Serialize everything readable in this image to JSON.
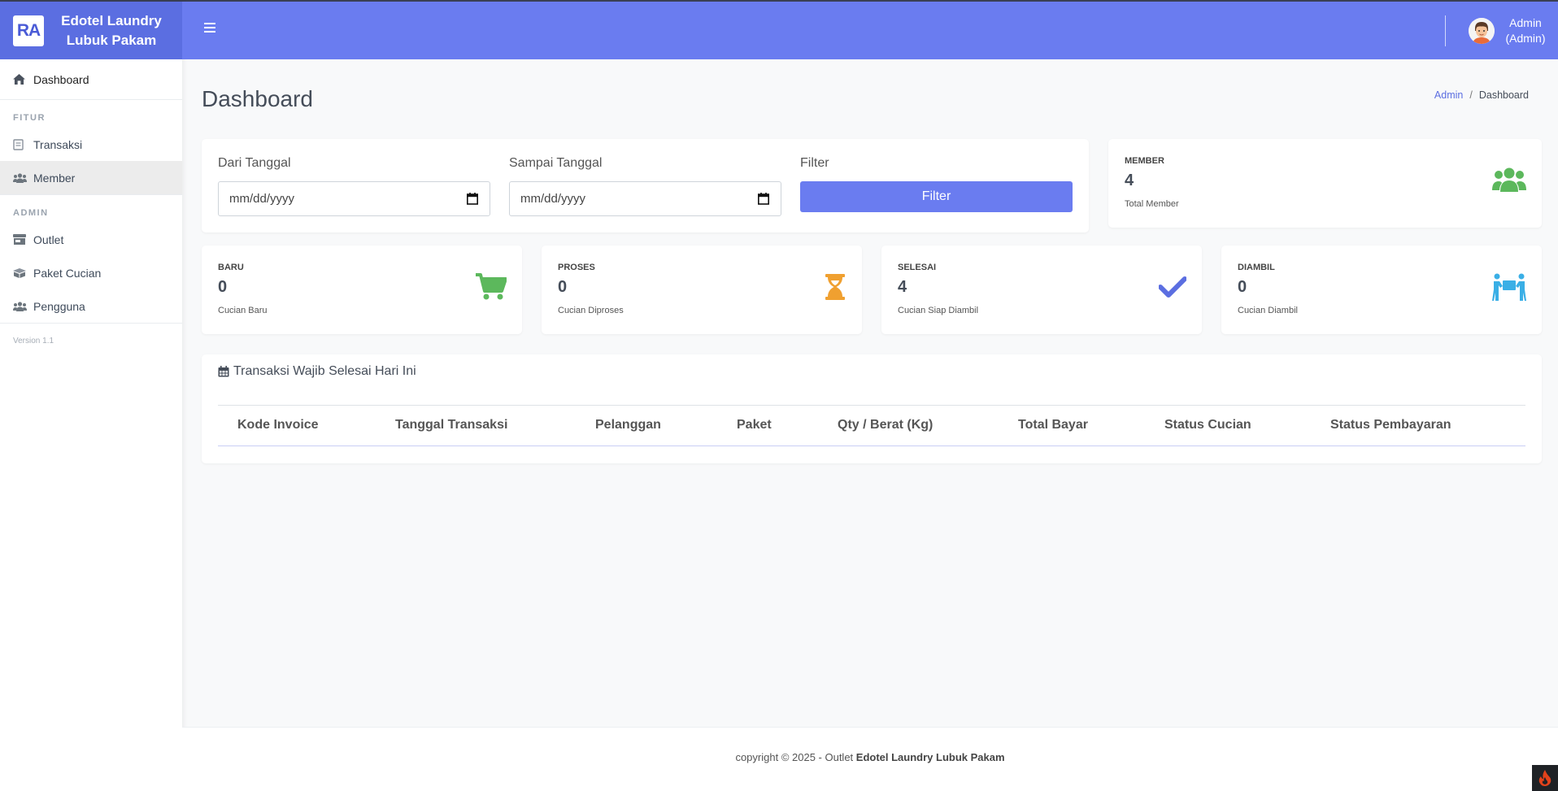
{
  "brand": {
    "logo_text": "RA",
    "name_line1": "Edotel Laundry",
    "name_line2": "Lubuk Pakam"
  },
  "sidebar": {
    "dashboard": "Dashboard",
    "fitur_heading": "FITUR",
    "fitur_items": [
      {
        "label": "Transaksi",
        "icon": "receipt-icon"
      },
      {
        "label": "Member",
        "icon": "users-icon"
      }
    ],
    "admin_heading": "ADMIN",
    "admin_items": [
      {
        "label": "Outlet",
        "icon": "store-icon"
      },
      {
        "label": "Paket Cucian",
        "icon": "box-icon"
      },
      {
        "label": "Pengguna",
        "icon": "users-icon"
      }
    ],
    "version": "Version 1.1"
  },
  "navbar": {
    "user_line1": "Admin",
    "user_line2": "(Admin)"
  },
  "page": {
    "title": "Dashboard",
    "breadcrumb": [
      "Admin",
      "Dashboard"
    ]
  },
  "filter": {
    "from_label": "Dari Tanggal",
    "from_placeholder": "mm/dd/yyyy",
    "to_label": "Sampai Tanggal",
    "to_placeholder": "mm/dd/yyyy",
    "filter_label": "Filter",
    "button": "Filter"
  },
  "stats": {
    "member": {
      "label": "MEMBER",
      "value": "4",
      "sub": "Total Member",
      "icon": "users-icon",
      "color": "#5cb85c"
    },
    "baru": {
      "label": "BARU",
      "value": "0",
      "sub": "Cucian Baru",
      "icon": "cart-icon",
      "color": "#5cb85c"
    },
    "proses": {
      "label": "PROSES",
      "value": "0",
      "sub": "Cucian Diproses",
      "icon": "hourglass-icon",
      "color": "#f0a030"
    },
    "selesai": {
      "label": "SELESAI",
      "value": "4",
      "sub": "Cucian Siap Diambil",
      "icon": "check-icon",
      "color": "#5b6ee1"
    },
    "diambil": {
      "label": "DIAMBIL",
      "value": "0",
      "sub": "Cucian Diambil",
      "icon": "people-carry-icon",
      "color": "#3aafe6"
    }
  },
  "table": {
    "title": "Transaksi Wajib Selesai Hari Ini",
    "columns": [
      "Kode Invoice",
      "Tanggal Transaksi",
      "Pelanggan",
      "Paket",
      "Qty / Berat (Kg)",
      "Total Bayar",
      "Status Cucian",
      "Status Pembayaran"
    ]
  },
  "footer": {
    "prefix": "copyright © 2025 - Outlet ",
    "outlet": "Edotel Laundry Lubuk Pakam"
  },
  "colors": {
    "primary": "#6a7cf0",
    "brand": "#5b6ee1"
  }
}
